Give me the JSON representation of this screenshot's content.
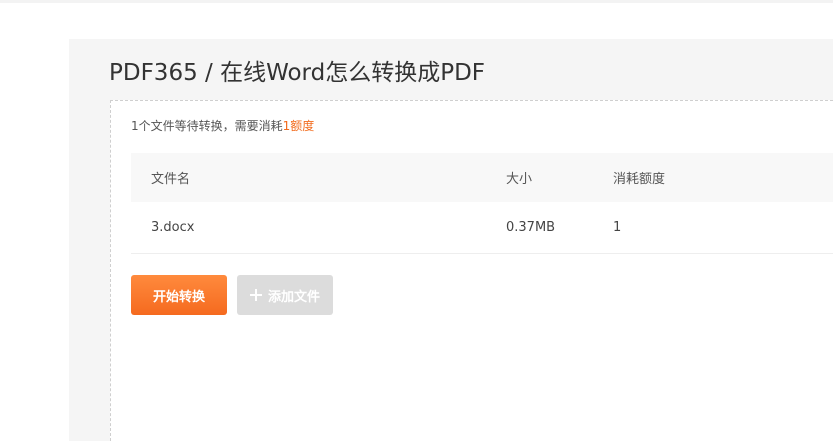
{
  "page": {
    "title": "PDF365 / 在线Word怎么转换成PDF"
  },
  "notice": {
    "prefix": "1个文件等待转换，需要消耗",
    "quota": "1额度"
  },
  "table": {
    "headers": {
      "name": "文件名",
      "size": "大小",
      "quota": "消耗额度"
    },
    "rows": [
      {
        "name": "3.docx",
        "size": "0.37MB",
        "quota": "1"
      }
    ]
  },
  "actions": {
    "start_label": "开始转换",
    "add_label": "添加文件"
  },
  "colors": {
    "accent": "#f26a1b",
    "start_button": "#f56a1f",
    "add_button_disabled": "#dcdcdc",
    "panel_bg": "#f5f5f5"
  },
  "icons": {
    "add_button": "plus-icon"
  }
}
